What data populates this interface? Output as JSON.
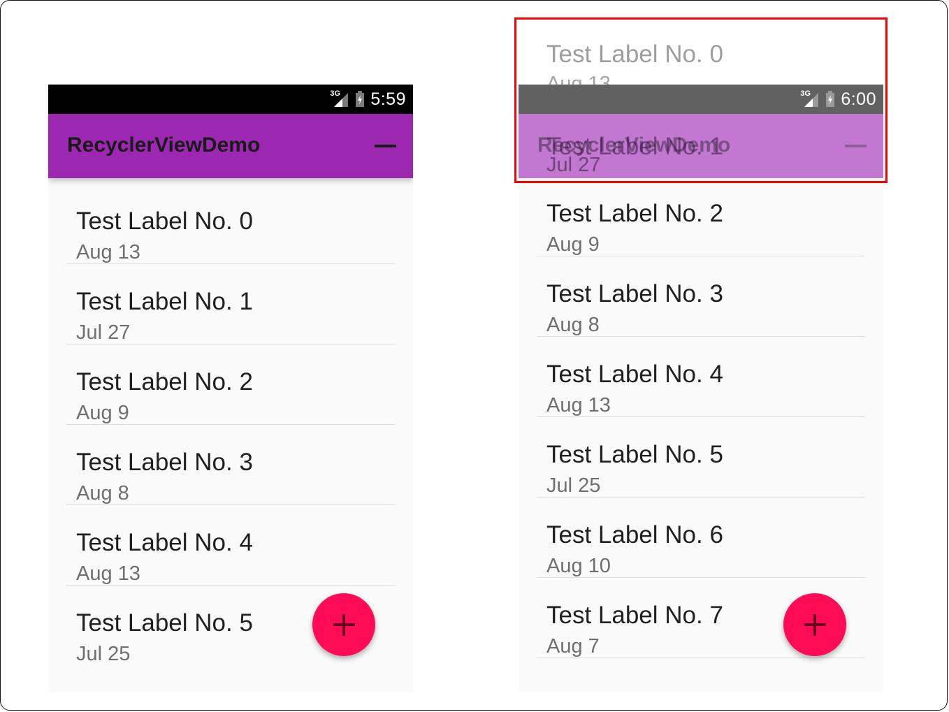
{
  "left_phone": {
    "status": {
      "network": "3G",
      "time": "5:59"
    },
    "app_title": "RecyclerViewDemo",
    "items": [
      {
        "label": "Test Label No. 0",
        "date": "Aug 13"
      },
      {
        "label": "Test Label No. 1",
        "date": "Jul 27"
      },
      {
        "label": "Test Label No. 2",
        "date": "Aug 9"
      },
      {
        "label": "Test Label No. 3",
        "date": "Aug 8"
      },
      {
        "label": "Test Label No. 4",
        "date": "Aug 13"
      },
      {
        "label": "Test Label No. 5",
        "date": "Jul 25"
      }
    ],
    "fab_icon": "plus-icon"
  },
  "right_phone": {
    "status": {
      "network": "3G",
      "time": "6:00"
    },
    "app_title": "RecyclerViewDemo",
    "overflow_items": [
      {
        "label": "Test Label No. 0",
        "date": "Aug 13"
      },
      {
        "label": "Test Label No. 1",
        "date": "Jul 27"
      }
    ],
    "items": [
      {
        "label": "Test Label No. 2",
        "date": "Aug 9"
      },
      {
        "label": "Test Label No. 3",
        "date": "Aug 8"
      },
      {
        "label": "Test Label No. 4",
        "date": "Aug 13"
      },
      {
        "label": "Test Label No. 5",
        "date": "Jul 25"
      },
      {
        "label": "Test Label No. 6",
        "date": "Aug 10"
      },
      {
        "label": "Test Label No. 7",
        "date": "Aug 7"
      }
    ],
    "fab_icon": "plus-icon"
  },
  "colors": {
    "primary": "#9c27b0",
    "accent": "#ff0b56",
    "highlight": "#ff0000"
  }
}
